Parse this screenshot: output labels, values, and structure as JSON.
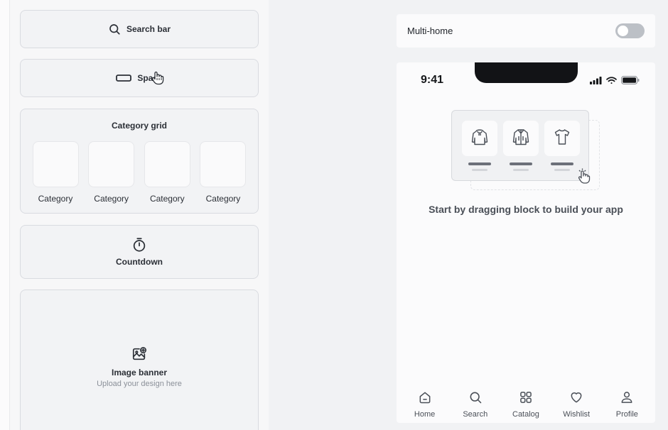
{
  "blocks": {
    "search_bar": {
      "label": "Search bar",
      "icon": "search-icon"
    },
    "space": {
      "label": "Space",
      "icon": "space-icon"
    },
    "category_grid": {
      "title": "Category grid",
      "items": [
        "Category",
        "Category",
        "Category",
        "Category"
      ]
    },
    "countdown": {
      "label": "Countdown",
      "icon": "timer-icon"
    },
    "image_banner": {
      "label": "Image banner",
      "subtitle": "Upload your design here",
      "icon": "image-add-icon"
    }
  },
  "multi_home": {
    "label": "Multi-home",
    "enabled": false
  },
  "phone": {
    "time": "9:41",
    "empty_message": "Start by dragging block to build your app",
    "illustration_items": [
      "hoodie-icon",
      "jacket-icon",
      "tshirt-icon"
    ],
    "tabs": [
      {
        "label": "Home",
        "icon": "home-icon"
      },
      {
        "label": "Search",
        "icon": "search-icon"
      },
      {
        "label": "Catalog",
        "icon": "grid-icon"
      },
      {
        "label": "Wishlist",
        "icon": "heart-icon"
      },
      {
        "label": "Profile",
        "icon": "user-icon"
      }
    ]
  },
  "colors": {
    "background": "#f1f2f4",
    "block_bg": "#f2f3f5",
    "block_border": "#d9dbe0",
    "text": "#1f2329",
    "muted": "#8b9099",
    "toggle_off": "#bcc0c6"
  }
}
